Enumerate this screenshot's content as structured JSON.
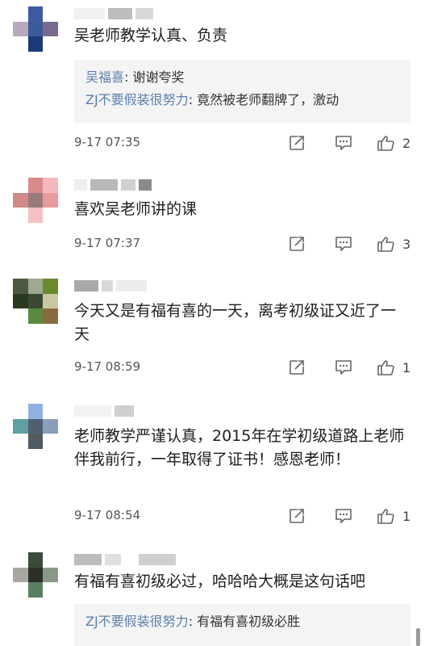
{
  "comments": [
    {
      "text": "吴老师教学认真、负责",
      "replies": [
        {
          "name": "吴福喜",
          "sep": ": ",
          "text": "谢谢夸奖"
        },
        {
          "name": "ZJ不要假装很努力",
          "sep": ": ",
          "text": "竟然被老师翻牌了，激动"
        }
      ],
      "time": "9-17 07:35",
      "likes": "2",
      "avatar": [
        "#ffffff",
        "#3c5aa0",
        "#ffffff",
        "#b8a8c0",
        "#3a5a9a",
        "#7a6a90",
        "#ffffff",
        "#1c3a78",
        "#ffffff"
      ]
    },
    {
      "text": "喜欢吴老师讲的课",
      "replies": [],
      "time": "9-17 07:37",
      "likes": "3",
      "avatar": [
        "#ffffff",
        "#d88a8a",
        "#f2b8bc",
        "#d08a88",
        "#9a7a7a",
        "#e89aa0",
        "#ffffff",
        "#f4c0c4",
        "#ffffff"
      ]
    },
    {
      "text": "今天又是有福有喜的一天，离考初级证又近了一天",
      "replies": [],
      "time": "9-17 08:59",
      "likes": "1",
      "avatar": [
        "#4a5a40",
        "#a0a890",
        "#6a8a30",
        "#2a3a20",
        "#3a4a30",
        "#c8c8a0",
        "#ffffff",
        "#5a8a40",
        "#8a6a40"
      ]
    },
    {
      "text": "老师教学严谨认真，2015年在学初级道路上老师伴我前行，一年取得了证书！感恩老师！",
      "replies": [],
      "time": "9-17 08:54",
      "likes": "1",
      "avatar": [
        "#ffffff",
        "#90b0e0",
        "#ffffff",
        "#60a0a0",
        "#506070",
        "#88a0b8",
        "#ffffff",
        "#505a60",
        "#ffffff"
      ]
    },
    {
      "text": "有福有喜初级必过，哈哈哈大概是这句话吧",
      "replies": [
        {
          "name": "ZJ不要假装很努力",
          "sep": ": ",
          "text": "有福有喜初级必胜"
        }
      ],
      "time": "",
      "likes": "",
      "avatar": [
        "#ffffff",
        "#3a4a3a",
        "#ffffff",
        "#a8a8a0",
        "#2a3028",
        "#8a9888",
        "#ffffff",
        "#5a8060",
        "#ffffff"
      ]
    }
  ]
}
